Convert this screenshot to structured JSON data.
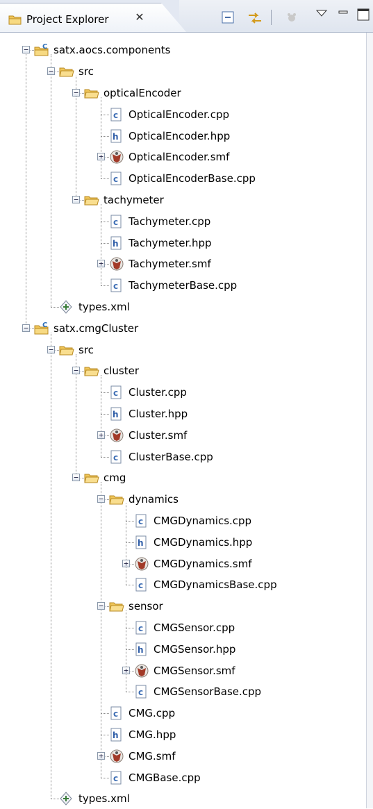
{
  "view": {
    "tab_title": "Project Explorer",
    "tab_close_glyph": "✕",
    "toolbar": [
      {
        "name": "collapse-all-icon"
      },
      {
        "name": "link-with-editor-icon"
      },
      {
        "name": "filter-icon"
      },
      {
        "name": "view-menu-icon"
      },
      {
        "name": "minimize-icon"
      },
      {
        "name": "maximize-icon"
      }
    ]
  },
  "colors": {
    "folder": "#e9b94a",
    "cpp_icon": "#3f6fb5",
    "hpp_icon": "#2f5ea8",
    "smf_icon": "#a23a28",
    "project": "#2d6fb9"
  },
  "tree": [
    {
      "level": 0,
      "type": "project",
      "label": "satx.aocs.components",
      "toggle": "−"
    },
    {
      "level": 1,
      "type": "folder",
      "label": "src",
      "toggle": "−"
    },
    {
      "level": 2,
      "type": "folder",
      "label": "opticalEncoder",
      "toggle": "−"
    },
    {
      "level": 3,
      "type": "cpp",
      "label": "OpticalEncoder.cpp"
    },
    {
      "level": 3,
      "type": "hpp",
      "label": "OpticalEncoder.hpp"
    },
    {
      "level": 3,
      "type": "smf",
      "label": "OpticalEncoder.smf",
      "toggle": "+"
    },
    {
      "level": 3,
      "type": "cpp",
      "label": "OpticalEncoderBase.cpp"
    },
    {
      "level": 2,
      "type": "folder",
      "label": "tachymeter",
      "toggle": "−"
    },
    {
      "level": 3,
      "type": "cpp",
      "label": "Tachymeter.cpp"
    },
    {
      "level": 3,
      "type": "hpp",
      "label": "Tachymeter.hpp"
    },
    {
      "level": 3,
      "type": "smf",
      "label": "Tachymeter.smf",
      "toggle": "+"
    },
    {
      "level": 3,
      "type": "cpp",
      "label": "TachymeterBase.cpp"
    },
    {
      "level": 1,
      "type": "xml",
      "label": "types.xml"
    },
    {
      "level": 0,
      "type": "project",
      "label": "satx.cmgCluster",
      "toggle": "−"
    },
    {
      "level": 1,
      "type": "folder",
      "label": "src",
      "toggle": "−"
    },
    {
      "level": 2,
      "type": "folder",
      "label": "cluster",
      "toggle": "−"
    },
    {
      "level": 3,
      "type": "cpp",
      "label": "Cluster.cpp"
    },
    {
      "level": 3,
      "type": "hpp",
      "label": "Cluster.hpp"
    },
    {
      "level": 3,
      "type": "smf",
      "label": "Cluster.smf",
      "toggle": "+"
    },
    {
      "level": 3,
      "type": "cpp",
      "label": "ClusterBase.cpp"
    },
    {
      "level": 2,
      "type": "folder",
      "label": "cmg",
      "toggle": "−"
    },
    {
      "level": 3,
      "type": "folder",
      "label": "dynamics",
      "toggle": "−"
    },
    {
      "level": 4,
      "type": "cpp",
      "label": "CMGDynamics.cpp"
    },
    {
      "level": 4,
      "type": "hpp",
      "label": "CMGDynamics.hpp"
    },
    {
      "level": 4,
      "type": "smf",
      "label": "CMGDynamics.smf",
      "toggle": "+"
    },
    {
      "level": 4,
      "type": "cpp",
      "label": "CMGDynamicsBase.cpp"
    },
    {
      "level": 3,
      "type": "folder",
      "label": "sensor",
      "toggle": "−"
    },
    {
      "level": 4,
      "type": "cpp",
      "label": "CMGSensor.cpp"
    },
    {
      "level": 4,
      "type": "hpp",
      "label": "CMGSensor.hpp"
    },
    {
      "level": 4,
      "type": "smf",
      "label": "CMGSensor.smf",
      "toggle": "+"
    },
    {
      "level": 4,
      "type": "cpp",
      "label": "CMGSensorBase.cpp"
    },
    {
      "level": 3,
      "type": "cpp",
      "label": "CMG.cpp"
    },
    {
      "level": 3,
      "type": "hpp",
      "label": "CMG.hpp"
    },
    {
      "level": 3,
      "type": "smf",
      "label": "CMG.smf",
      "toggle": "+"
    },
    {
      "level": 3,
      "type": "cpp",
      "label": "CMGBase.cpp"
    },
    {
      "level": 1,
      "type": "xml",
      "label": "types.xml"
    }
  ]
}
